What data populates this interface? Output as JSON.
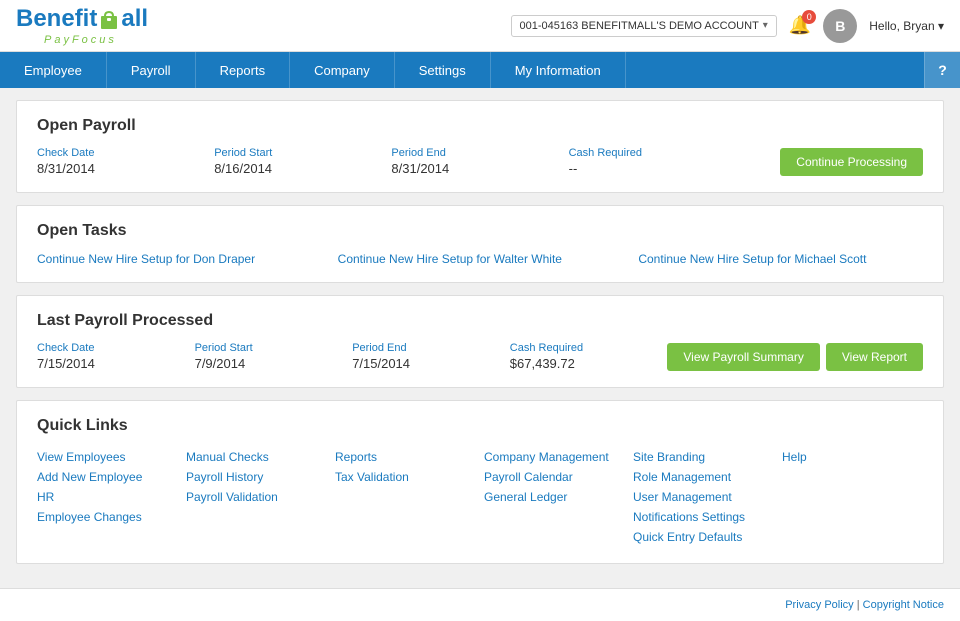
{
  "header": {
    "logo_benefit": "Benefit",
    "logo_m": "M",
    "logo_all": "all",
    "logo_payfocus": "PayFocus",
    "account_label": "001-045163 BENEFITMALL'S DEMO ACCOUNT",
    "notification_count": "0",
    "user_greeting": "Hello, Bryan",
    "user_caret": "▾"
  },
  "nav": {
    "items": [
      {
        "id": "employee",
        "label": "Employee"
      },
      {
        "id": "payroll",
        "label": "Payroll"
      },
      {
        "id": "reports",
        "label": "Reports"
      },
      {
        "id": "company",
        "label": "Company"
      },
      {
        "id": "settings",
        "label": "Settings"
      },
      {
        "id": "my-information",
        "label": "My Information"
      }
    ],
    "help_label": "?"
  },
  "open_payroll": {
    "title": "Open Payroll",
    "check_date_label": "Check Date",
    "check_date_value": "8/31/2014",
    "period_start_label": "Period Start",
    "period_start_value": "8/16/2014",
    "period_end_label": "Period End",
    "period_end_value": "8/31/2014",
    "cash_required_label": "Cash Required",
    "cash_required_value": "--",
    "button_label": "Continue Processing"
  },
  "open_tasks": {
    "title": "Open Tasks",
    "tasks": [
      {
        "id": "task-1",
        "label": "Continue New Hire Setup for Don Draper"
      },
      {
        "id": "task-2",
        "label": "Continue New Hire Setup for Walter White"
      },
      {
        "id": "task-3",
        "label": "Continue New Hire Setup for Michael Scott"
      }
    ]
  },
  "last_payroll": {
    "title": "Last Payroll Processed",
    "check_date_label": "Check Date",
    "check_date_value": "7/15/2014",
    "period_start_label": "Period Start",
    "period_start_value": "7/9/2014",
    "period_end_label": "Period End",
    "period_end_value": "7/15/2014",
    "cash_required_label": "Cash Required",
    "cash_required_value": "$67,439.72",
    "btn_summary_label": "View Payroll Summary",
    "btn_report_label": "View Report"
  },
  "quick_links": {
    "title": "Quick Links",
    "columns": [
      [
        {
          "id": "view-employees",
          "label": "View Employees"
        },
        {
          "id": "add-new-employee",
          "label": "Add New Employee"
        },
        {
          "id": "hr",
          "label": "HR"
        },
        {
          "id": "employee-changes",
          "label": "Employee Changes"
        }
      ],
      [
        {
          "id": "manual-checks",
          "label": "Manual Checks"
        },
        {
          "id": "payroll-history",
          "label": "Payroll History"
        },
        {
          "id": "payroll-validation",
          "label": "Payroll Validation"
        }
      ],
      [
        {
          "id": "reports",
          "label": "Reports"
        },
        {
          "id": "tax-validation",
          "label": "Tax Validation"
        }
      ],
      [
        {
          "id": "company-management",
          "label": "Company Management"
        },
        {
          "id": "payroll-calendar",
          "label": "Payroll Calendar"
        },
        {
          "id": "general-ledger",
          "label": "General Ledger"
        }
      ],
      [
        {
          "id": "site-branding",
          "label": "Site Branding"
        },
        {
          "id": "role-management",
          "label": "Role Management"
        },
        {
          "id": "user-management",
          "label": "User Management"
        },
        {
          "id": "notifications-settings",
          "label": "Notifications Settings"
        },
        {
          "id": "quick-entry-defaults",
          "label": "Quick Entry Defaults"
        }
      ],
      [
        {
          "id": "help",
          "label": "Help"
        }
      ]
    ]
  },
  "footer": {
    "privacy_label": "Privacy Policy",
    "separator": " | ",
    "copyright_label": "Copyright Notice"
  }
}
